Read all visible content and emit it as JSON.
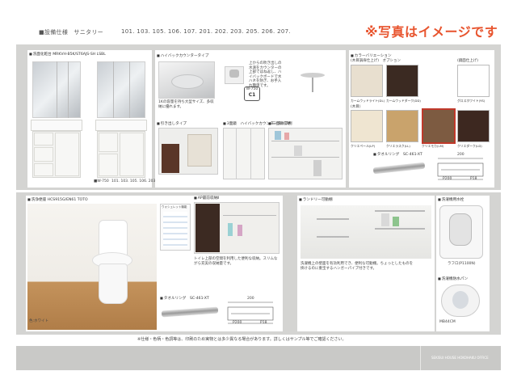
{
  "header": {
    "title": "■設備仕様　サニタリー",
    "units": "101. 103. 105. 106. 107. 201. 202. 203. 205. 206. 207.",
    "notice": "※写真はイメージです"
  },
  "vanity": {
    "label": "洗面化粧台 MRKVH-B5K/ST6AJS-SH LSBL",
    "unit_left": "■W-750",
    "unit_right": "101. 103. 105. 106. 203",
    "countertop_label": "ハイバックカウンタータイプ",
    "countertop_desc": "上からの吹き出しの水滴をカウンターの上部ではね返し、ハイバックボードで水ハネを防ぎ、お手入れ簡単です。",
    "drawer_label": "引き出しタイプ",
    "drawer_desc": "1Kの容量を持ち大型サイズ、多収納に優れます。",
    "cabinet_label": "3面鏡　ハイバックカウンタータイプ例",
    "storage_label": "三面鏡収納",
    "badge": "W-750",
    "badge_sub": "C1"
  },
  "colors": {
    "label": "カラーバリエーション",
    "sub_label": "(木目調扉仕上げ)　オプション",
    "sub_label_right": "(鏡面仕上げ)",
    "items": [
      {
        "name": "カームウッドライト(DL)",
        "color": "#e8dfcf"
      },
      {
        "name": "カームウッドダーク(DD)",
        "color": "#3b2a22"
      },
      {
        "name": "グロスホワイト(YS)",
        "color": "#ffffff"
      },
      {
        "name": "クリエペール(LP)",
        "color": "#efe5d1"
      },
      {
        "name": "クリエラスク(LL)",
        "color": "#c9a36c"
      },
      {
        "name": "クリエモカ(LM)",
        "color": "#7d5b41"
      },
      {
        "name": "クリエダーク(LD)",
        "color": "#3d2820"
      }
    ],
    "wood_label": "(木目)"
  },
  "towel_top": {
    "label": "タオルリング　SC-461-XT",
    "dims": [
      "200",
      "P200",
      "P18"
    ]
  },
  "toilet": {
    "label": "洗浄便座 HCS915G/EN61 TOTO",
    "color_note": "色:ホワイト",
    "remote_label": "ウォシュレット機能",
    "cabinet_label": "AP最前収納Ⅱ",
    "cabinet_desc": "トイレ上部の空間を利用した便利な収納。スリムながら充実の収納量です。",
    "towel_label": "タオルリング　SC-461-XT",
    "towel_dims": [
      "200",
      "P200",
      "P18"
    ]
  },
  "laundry": {
    "label": "ランドリー可動棚",
    "desc": "洗濯機上の壁面を有効利用でき、便利な可動棚。ちょっとしたものを掛けるのに重宝するハンガーパイプ付きです。",
    "faucet_label": "洗濯機用水栓",
    "faucet_model": "ラフロ(P1100N)",
    "pan_label": "洗濯機防水パン",
    "pan_model": "MB44CM"
  },
  "footer": {
    "note": "※仕様・色柄・色調等は、印刷のため実物とは多少異なる場合があります。詳しくはサンプル等でご確認ください。",
    "brand": "SEKISUI HOUSE HOKOHAKU OFFICE"
  }
}
